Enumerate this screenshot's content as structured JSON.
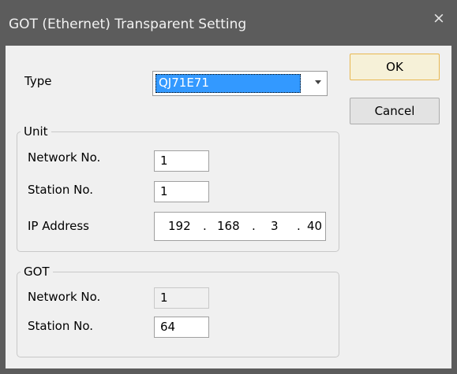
{
  "window": {
    "title": "GOT (Ethernet) Transparent Setting",
    "close_glyph": "×"
  },
  "buttons": {
    "ok": "OK",
    "cancel": "Cancel"
  },
  "type": {
    "label": "Type",
    "value": "QJ71E71"
  },
  "unit": {
    "legend": "Unit",
    "network_label": "Network No.",
    "network_value": "1",
    "station_label": "Station No.",
    "station_value": "1",
    "ip_label": "IP Address",
    "ip": [
      "192",
      "168",
      "3",
      "40"
    ],
    "ip_sep": "."
  },
  "got": {
    "legend": "GOT",
    "network_label": "Network No.",
    "network_value": "1",
    "station_label": "Station No.",
    "station_value": "64"
  }
}
